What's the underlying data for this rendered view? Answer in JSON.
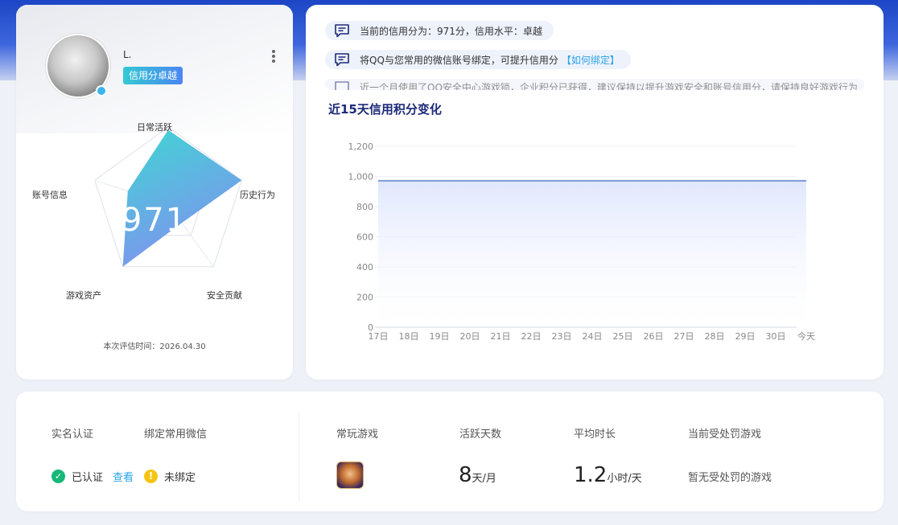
{
  "profile": {
    "username": "L.",
    "level_badge": "信用分卓越",
    "score": "971",
    "eval_time": "本次评估时间：2026.04.30",
    "radar": {
      "labels": {
        "daily": "日常活跃",
        "history": "历史行为",
        "security": "安全贡献",
        "assets": "游戏资产",
        "account": "账号信息"
      }
    }
  },
  "notices": [
    {
      "text": "当前的信用分为：971分，信用水平：卓越"
    },
    {
      "text": "将QQ与您常用的微信账号绑定，可提升信用分",
      "link": "【如何绑定】"
    },
    {
      "text": "近一个月使用了QQ安全中心游戏锁，企业积分已获得，建议保持以提升游戏安全和账号信用分，请保持良好游戏行为"
    }
  ],
  "chart_title": "近15天信用积分变化",
  "chart_data": {
    "type": "area",
    "categories": [
      "17日",
      "18日",
      "19日",
      "20日",
      "21日",
      "22日",
      "23日",
      "24日",
      "25日",
      "26日",
      "27日",
      "28日",
      "29日",
      "30日",
      "今天"
    ],
    "series": [
      {
        "values": [
          971,
          971,
          971,
          971,
          971,
          971,
          971,
          971,
          971,
          971,
          971,
          971,
          971,
          971,
          971
        ]
      }
    ],
    "yticks": [
      "0",
      "200",
      "400",
      "600",
      "800",
      "1,000",
      "1,200"
    ],
    "ylim": [
      0,
      1200
    ],
    "grid": true,
    "line_color": "#7c9ad8",
    "fill_color": "#dfe6fc"
  },
  "stats": {
    "realname_label": "实名认证",
    "realname_status": "已认证",
    "realname_link": "查看",
    "wechat_label": "绑定常用微信",
    "wechat_status": "未绑定",
    "games_label": "常玩游戏",
    "active_days_label": "活跃天数",
    "active_days_value": "8",
    "active_days_unit": "天/月",
    "avg_time_label": "平均时长",
    "avg_time_value": "1.2",
    "avg_time_unit": "小时/天",
    "penalty_label": "当前受处罚游戏",
    "penalty_value": "暂无受处罚的游戏"
  },
  "colors": {
    "accent": "#2aa4e8",
    "success": "#16b777",
    "warning": "#f6c310",
    "title": "#1d2a78"
  }
}
